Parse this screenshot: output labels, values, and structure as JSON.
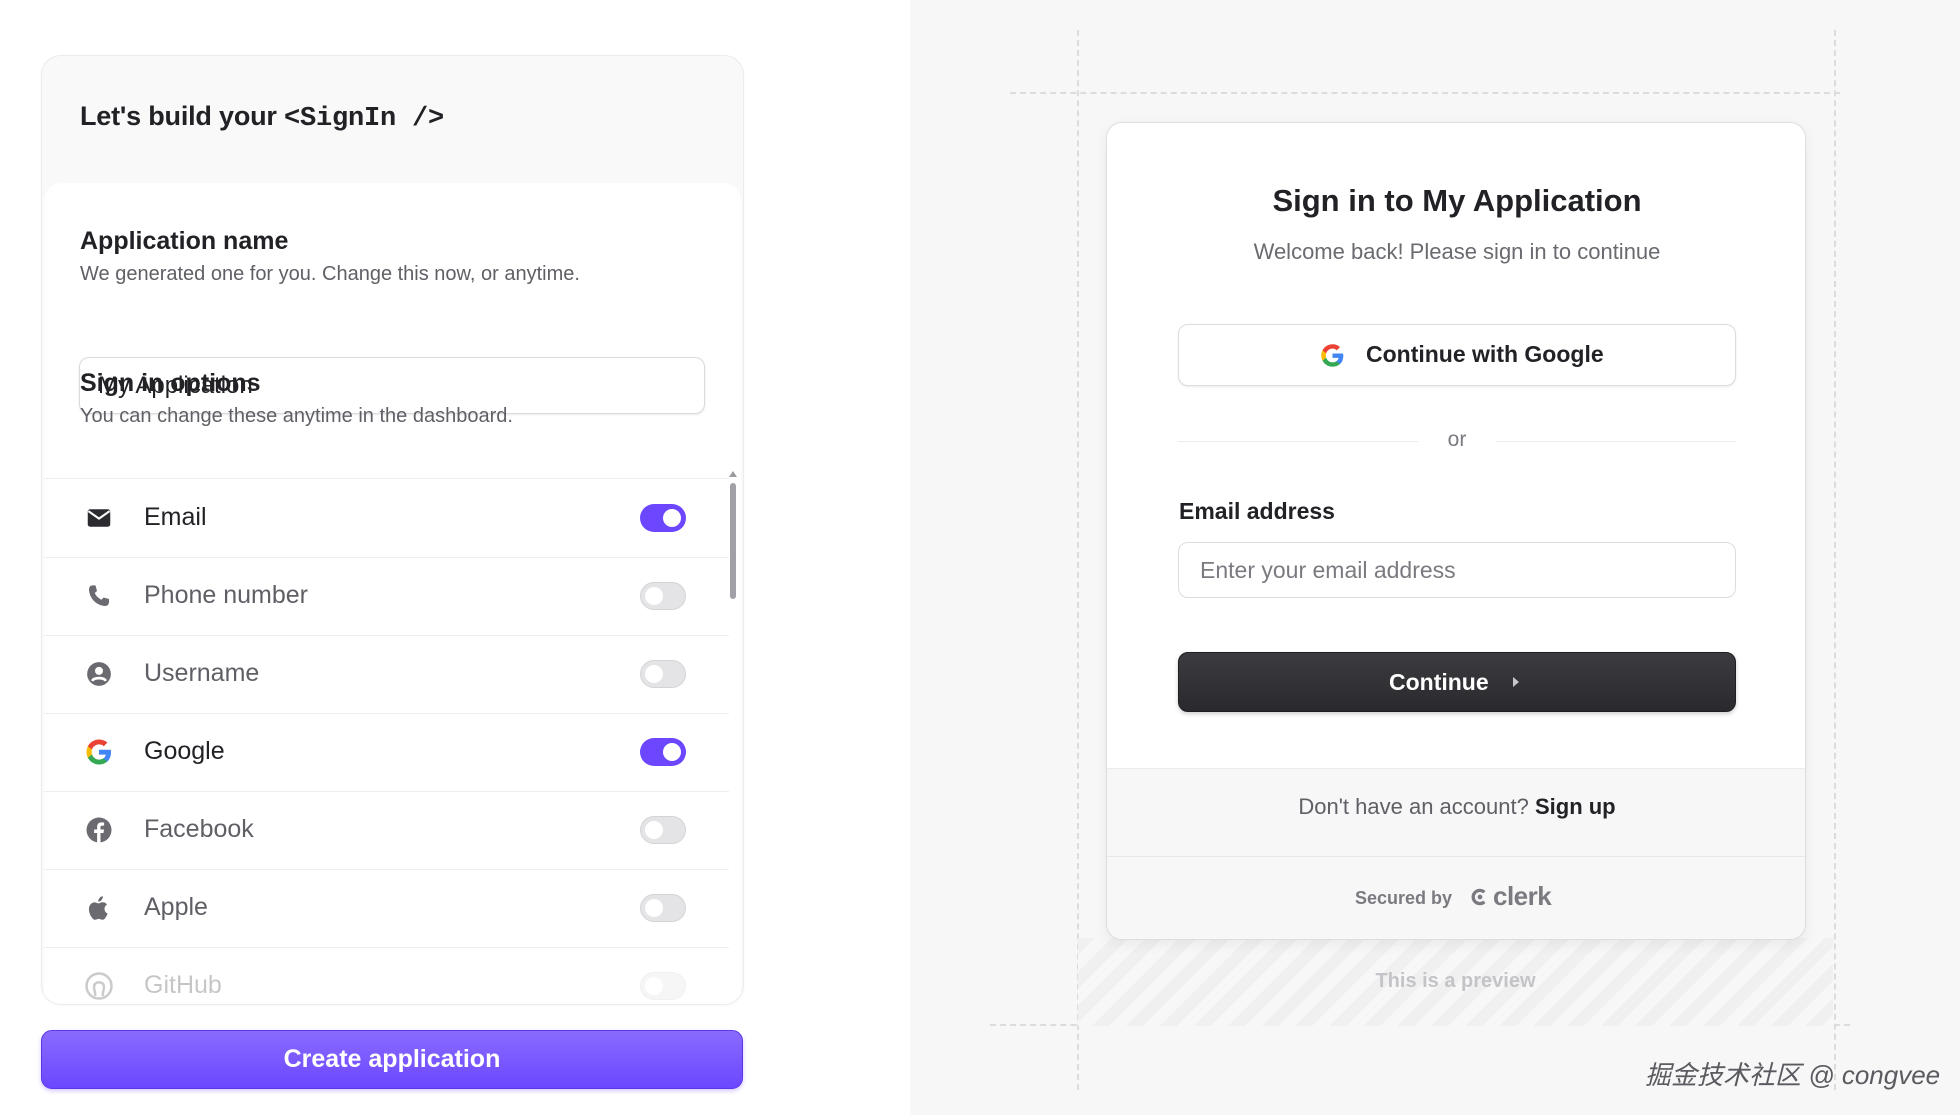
{
  "builder": {
    "title_prefix": "Let's build your ",
    "title_code": "<SignIn />",
    "app_name": {
      "title": "Application name",
      "description": "We generated one for you. Change this now, or anytime.",
      "value": "My Application"
    },
    "signin_options": {
      "title": "Sign in options",
      "description": "You can change these anytime in the dashboard.",
      "items": [
        {
          "label": "Email",
          "icon": "envelope-icon",
          "enabled": true
        },
        {
          "label": "Phone number",
          "icon": "phone-icon",
          "enabled": false
        },
        {
          "label": "Username",
          "icon": "user-circle-icon",
          "enabled": false
        },
        {
          "label": "Google",
          "icon": "google-icon",
          "enabled": true
        },
        {
          "label": "Facebook",
          "icon": "facebook-icon",
          "enabled": false
        },
        {
          "label": "Apple",
          "icon": "apple-icon",
          "enabled": false
        },
        {
          "label": "GitHub",
          "icon": "github-icon",
          "enabled": false
        }
      ]
    },
    "create_button": "Create application"
  },
  "preview": {
    "title": "Sign in to My Application",
    "subtitle": "Welcome back! Please sign in to continue",
    "google_button": "Continue with Google",
    "divider": "or",
    "email_label": "Email address",
    "email_placeholder": "Enter your email address",
    "continue_button": "Continue",
    "footer_text": "Don't have an account?",
    "signup_link": "Sign up",
    "secured_by": "Secured by",
    "brand": "clerk",
    "preview_note": "This is a preview"
  },
  "watermark": "掘金技术社区 @ congvee",
  "colors": {
    "accent": "#6c47ff",
    "dark_button": "#2f2f33",
    "text": "#212126",
    "muted": "#5f5f66"
  }
}
